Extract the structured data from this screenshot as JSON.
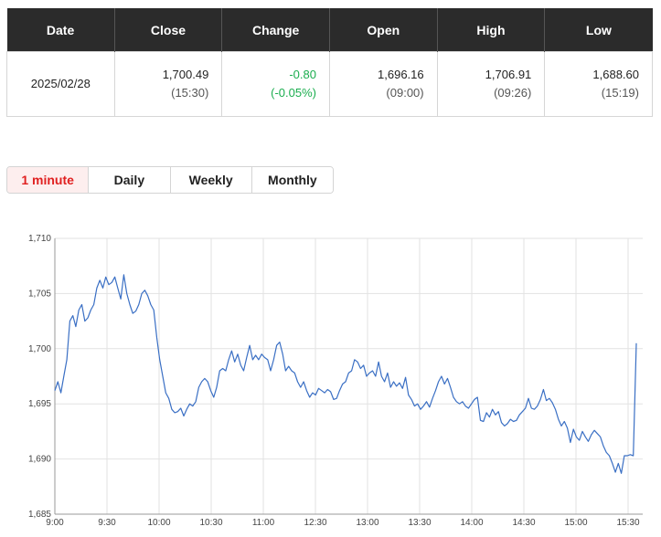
{
  "quote": {
    "headers": [
      "Date",
      "Close",
      "Change",
      "Open",
      "High",
      "Low"
    ],
    "date": "2025/02/28",
    "close": "1,700.49",
    "close_time": "(15:30)",
    "change": "-0.80",
    "change_pct": "(-0.05%)",
    "open": "1,696.16",
    "open_time": "(09:00)",
    "high": "1,706.91",
    "high_time": "(09:26)",
    "low": "1,688.60",
    "low_time": "(15:19)",
    "change_color": "#1aad4e"
  },
  "tabs": [
    {
      "label": "1 minute",
      "active": true
    },
    {
      "label": "Daily",
      "active": false
    },
    {
      "label": "Weekly",
      "active": false
    },
    {
      "label": "Monthly",
      "active": false
    }
  ],
  "chart_data": {
    "type": "line",
    "title": "",
    "xlabel": "",
    "ylabel": "",
    "ylim": [
      1685,
      1710
    ],
    "y_ticks": [
      1685,
      1690,
      1695,
      1700,
      1705,
      1710
    ],
    "y_tick_labels": [
      "1,685",
      "1,690",
      "1,695",
      "1,700",
      "1,705",
      "1,710"
    ],
    "x_ticks": [
      "9:00",
      "9:30",
      "10:00",
      "10:30",
      "11:00",
      "12:30",
      "13:00",
      "13:30",
      "14:00",
      "14:30",
      "15:00",
      "15:30"
    ],
    "grid": true,
    "line_color": "#3a6fc4",
    "series": [
      {
        "values": [
          [
            0,
            1696.2
          ],
          [
            1,
            1697.0
          ],
          [
            2,
            1696.0
          ],
          [
            3,
            1697.5
          ],
          [
            4,
            1699.0
          ],
          [
            5,
            1702.5
          ],
          [
            6,
            1703.0
          ],
          [
            7,
            1702.0
          ],
          [
            8,
            1703.5
          ],
          [
            9,
            1704.0
          ],
          [
            10,
            1702.5
          ],
          [
            11,
            1702.8
          ],
          [
            12,
            1703.5
          ],
          [
            13,
            1704.0
          ],
          [
            14,
            1705.5
          ],
          [
            15,
            1706.2
          ],
          [
            16,
            1705.5
          ],
          [
            17,
            1706.5
          ],
          [
            18,
            1705.8
          ],
          [
            19,
            1706.0
          ],
          [
            20,
            1706.5
          ],
          [
            21,
            1705.5
          ],
          [
            22,
            1704.5
          ],
          [
            23,
            1706.7
          ],
          [
            24,
            1705.0
          ],
          [
            25,
            1704.0
          ],
          [
            26,
            1703.2
          ],
          [
            27,
            1703.4
          ],
          [
            28,
            1704.0
          ],
          [
            29,
            1705.0
          ],
          [
            30,
            1705.3
          ],
          [
            31,
            1704.8
          ],
          [
            32,
            1704.0
          ],
          [
            33,
            1703.5
          ],
          [
            34,
            1701.0
          ],
          [
            35,
            1699.0
          ],
          [
            36,
            1697.5
          ],
          [
            37,
            1696.0
          ],
          [
            38,
            1695.5
          ],
          [
            39,
            1694.5
          ],
          [
            40,
            1694.2
          ],
          [
            41,
            1694.3
          ],
          [
            42,
            1694.6
          ],
          [
            43,
            1693.9
          ],
          [
            44,
            1694.5
          ],
          [
            45,
            1695.0
          ],
          [
            46,
            1694.8
          ],
          [
            47,
            1695.2
          ],
          [
            48,
            1696.5
          ],
          [
            49,
            1697.0
          ],
          [
            50,
            1697.3
          ],
          [
            51,
            1697.0
          ],
          [
            52,
            1696.2
          ],
          [
            53,
            1695.6
          ],
          [
            54,
            1696.5
          ],
          [
            55,
            1698.0
          ],
          [
            56,
            1698.2
          ],
          [
            57,
            1698.0
          ],
          [
            58,
            1699.0
          ],
          [
            59,
            1699.8
          ],
          [
            60,
            1698.8
          ],
          [
            61,
            1699.5
          ],
          [
            62,
            1698.5
          ],
          [
            63,
            1698.0
          ],
          [
            64,
            1699.2
          ],
          [
            65,
            1700.3
          ],
          [
            66,
            1699.0
          ],
          [
            67,
            1699.4
          ],
          [
            68,
            1699.0
          ],
          [
            69,
            1699.5
          ],
          [
            70,
            1699.2
          ],
          [
            71,
            1699.0
          ],
          [
            72,
            1698.0
          ],
          [
            73,
            1699.0
          ],
          [
            74,
            1700.3
          ],
          [
            75,
            1700.6
          ],
          [
            76,
            1699.5
          ],
          [
            77,
            1698.0
          ],
          [
            78,
            1698.4
          ],
          [
            79,
            1698.0
          ],
          [
            80,
            1697.8
          ],
          [
            81,
            1697.0
          ],
          [
            82,
            1696.5
          ],
          [
            83,
            1697.0
          ],
          [
            84,
            1696.2
          ],
          [
            85,
            1695.6
          ],
          [
            86,
            1696.0
          ],
          [
            87,
            1695.8
          ],
          [
            88,
            1696.4
          ],
          [
            89,
            1696.2
          ],
          [
            90,
            1696.0
          ],
          [
            91,
            1696.3
          ],
          [
            92,
            1696.1
          ],
          [
            93,
            1695.4
          ],
          [
            94,
            1695.5
          ],
          [
            95,
            1696.2
          ],
          [
            96,
            1696.8
          ],
          [
            97,
            1697.0
          ],
          [
            98,
            1697.8
          ],
          [
            99,
            1698.0
          ],
          [
            100,
            1699.0
          ],
          [
            101,
            1698.8
          ],
          [
            102,
            1698.2
          ],
          [
            103,
            1698.5
          ],
          [
            104,
            1697.5
          ],
          [
            105,
            1697.8
          ],
          [
            106,
            1698.0
          ],
          [
            107,
            1697.5
          ],
          [
            108,
            1698.8
          ],
          [
            109,
            1697.5
          ],
          [
            110,
            1697.0
          ],
          [
            111,
            1697.8
          ],
          [
            112,
            1696.5
          ],
          [
            113,
            1697.0
          ],
          [
            114,
            1696.6
          ],
          [
            115,
            1696.9
          ],
          [
            116,
            1696.4
          ],
          [
            117,
            1697.4
          ],
          [
            118,
            1695.8
          ],
          [
            119,
            1695.4
          ],
          [
            120,
            1694.8
          ],
          [
            121,
            1695.0
          ],
          [
            122,
            1694.5
          ],
          [
            123,
            1694.8
          ],
          [
            124,
            1695.2
          ],
          [
            125,
            1694.7
          ],
          [
            126,
            1695.5
          ],
          [
            127,
            1696.2
          ],
          [
            128,
            1697.0
          ],
          [
            129,
            1697.5
          ],
          [
            130,
            1696.8
          ],
          [
            131,
            1697.3
          ],
          [
            132,
            1696.5
          ],
          [
            133,
            1695.6
          ],
          [
            134,
            1695.2
          ],
          [
            135,
            1695.0
          ],
          [
            136,
            1695.2
          ],
          [
            137,
            1694.8
          ],
          [
            138,
            1694.6
          ],
          [
            139,
            1695.0
          ],
          [
            140,
            1695.4
          ],
          [
            141,
            1695.6
          ],
          [
            142,
            1693.5
          ],
          [
            143,
            1693.4
          ],
          [
            144,
            1694.2
          ],
          [
            145,
            1693.8
          ],
          [
            146,
            1694.5
          ],
          [
            147,
            1694.0
          ],
          [
            148,
            1694.3
          ],
          [
            149,
            1693.3
          ],
          [
            150,
            1693.0
          ],
          [
            151,
            1693.2
          ],
          [
            152,
            1693.6
          ],
          [
            153,
            1693.4
          ],
          [
            154,
            1693.5
          ],
          [
            155,
            1694.0
          ],
          [
            156,
            1694.3
          ],
          [
            157,
            1694.6
          ],
          [
            158,
            1695.5
          ],
          [
            159,
            1694.6
          ],
          [
            160,
            1694.5
          ],
          [
            161,
            1694.8
          ],
          [
            162,
            1695.4
          ],
          [
            163,
            1696.3
          ],
          [
            164,
            1695.3
          ],
          [
            165,
            1695.5
          ],
          [
            166,
            1695.1
          ],
          [
            167,
            1694.5
          ],
          [
            168,
            1693.6
          ],
          [
            169,
            1693.0
          ],
          [
            170,
            1693.4
          ],
          [
            171,
            1692.8
          ],
          [
            172,
            1691.5
          ],
          [
            173,
            1692.7
          ],
          [
            174,
            1692.0
          ],
          [
            175,
            1691.7
          ],
          [
            176,
            1692.5
          ],
          [
            177,
            1692.0
          ],
          [
            178,
            1691.6
          ],
          [
            179,
            1692.2
          ],
          [
            180,
            1692.6
          ],
          [
            181,
            1692.3
          ],
          [
            182,
            1692.0
          ],
          [
            183,
            1691.2
          ],
          [
            184,
            1690.6
          ],
          [
            185,
            1690.3
          ],
          [
            186,
            1689.6
          ],
          [
            187,
            1688.8
          ],
          [
            188,
            1689.6
          ],
          [
            189,
            1688.7
          ],
          [
            190,
            1690.3
          ],
          [
            191,
            1690.3
          ],
          [
            192,
            1690.4
          ],
          [
            193,
            1690.3
          ],
          [
            194,
            1700.5
          ]
        ]
      }
    ]
  }
}
